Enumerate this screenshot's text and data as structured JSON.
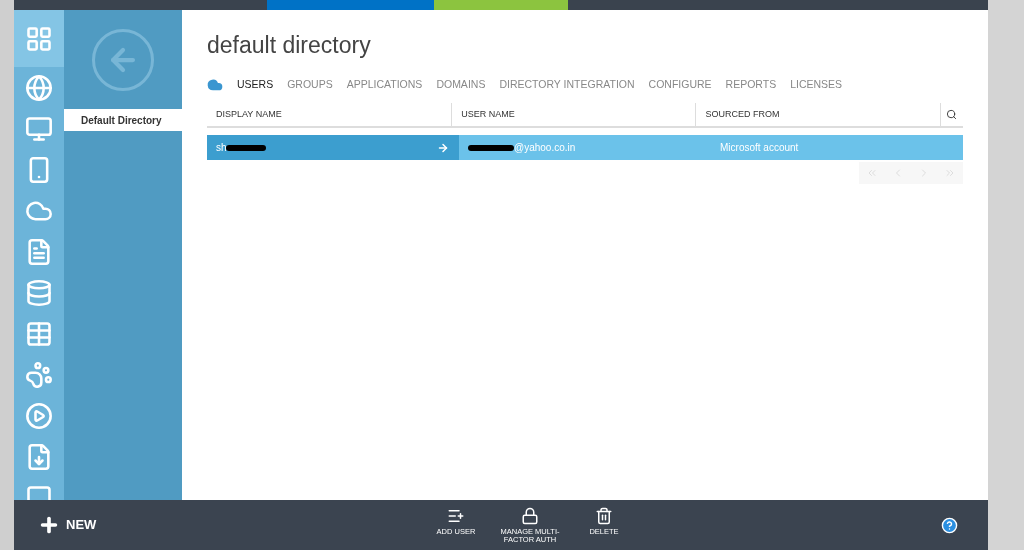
{
  "nav_icons": [
    {
      "kind": "all",
      "selected": true
    },
    {
      "kind": "web",
      "selected": false
    },
    {
      "kind": "vm",
      "selected": false
    },
    {
      "kind": "mobile",
      "selected": false
    },
    {
      "kind": "cloud",
      "selected": false
    },
    {
      "kind": "batch",
      "selected": false
    },
    {
      "kind": "db",
      "selected": false
    },
    {
      "kind": "table",
      "selected": false
    },
    {
      "kind": "hadoop",
      "selected": false
    },
    {
      "kind": "media",
      "selected": false
    },
    {
      "kind": "import",
      "selected": false
    },
    {
      "kind": "more",
      "selected": false
    }
  ],
  "directory_list": [
    {
      "label": "Default Directory",
      "selected": true
    }
  ],
  "title": "default directory",
  "tabs": [
    {
      "label": "USERS",
      "selected": true
    },
    {
      "label": "GROUPS",
      "selected": false
    },
    {
      "label": "APPLICATIONS",
      "selected": false
    },
    {
      "label": "DOMAINS",
      "selected": false
    },
    {
      "label": "DIRECTORY INTEGRATION",
      "selected": false
    },
    {
      "label": "CONFIGURE",
      "selected": false
    },
    {
      "label": "REPORTS",
      "selected": false
    },
    {
      "label": "LICENSES",
      "selected": false
    }
  ],
  "table": {
    "columns": [
      "DISPLAY NAME",
      "USER NAME",
      "SOURCED FROM"
    ],
    "rows": [
      {
        "display_name": "sh",
        "user_name": "@yahoo.co.in",
        "sourced_from": "Microsoft account",
        "selected": true
      }
    ]
  },
  "command_bar": {
    "new": "NEW",
    "actions": [
      {
        "kind": "add",
        "label": "ADD USER"
      },
      {
        "kind": "lock",
        "label": "MANAGE MULTI-FACTOR AUTH"
      },
      {
        "kind": "delete",
        "label": "DELETE"
      }
    ]
  }
}
